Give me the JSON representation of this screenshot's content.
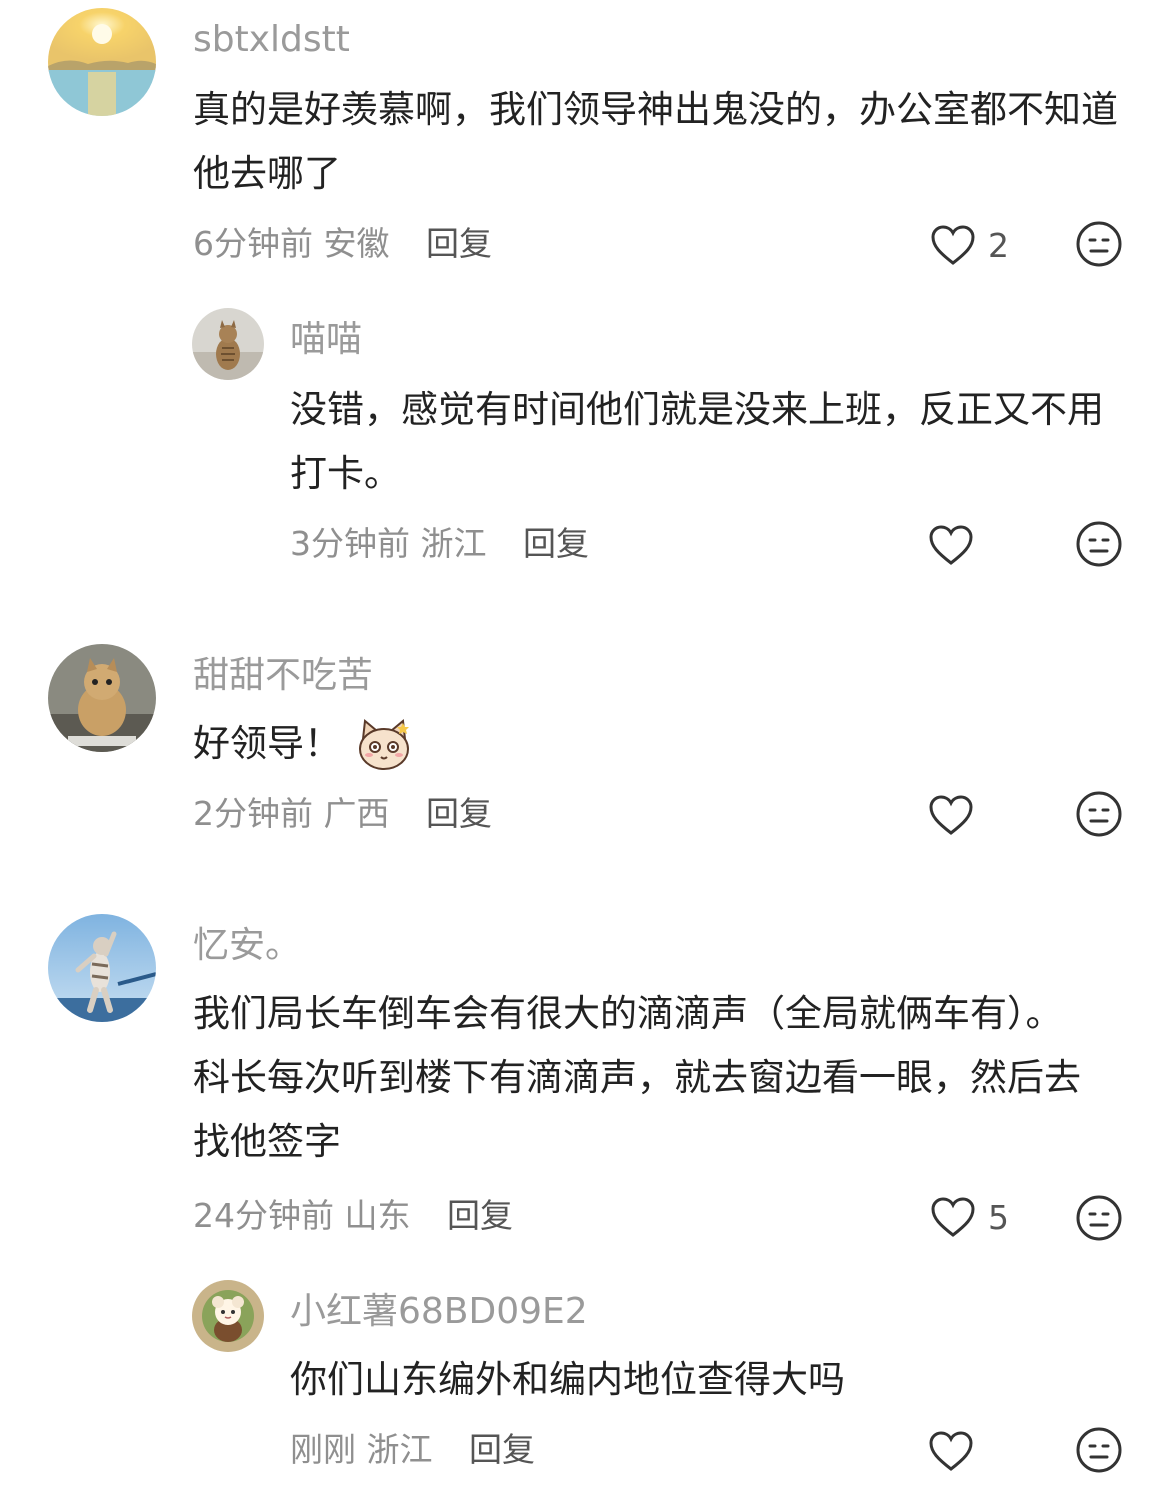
{
  "comments": [
    {
      "username": "sbtxldstt",
      "text": "真的是好羡慕啊，我们领导神出鬼没的，办公室都不知道他去哪了",
      "time": "6分钟前",
      "location": "安徽",
      "reply_label": "回复",
      "like_count": "2",
      "avatar_icon": "sunset-sea-avatar",
      "replies": [
        {
          "username": "喵喵",
          "text": "没错，感觉有时间他们就是没来上班，反正又不用打卡。",
          "time": "3分钟前",
          "location": "浙江",
          "reply_label": "回复",
          "like_count": "",
          "avatar_icon": "cat-avatar"
        }
      ]
    },
    {
      "username": "甜甜不吃苦",
      "text": "好领导！",
      "emoji_icon": "cat-sticker-emoji",
      "time": "2分钟前",
      "location": "广西",
      "reply_label": "回复",
      "like_count": "",
      "avatar_icon": "cat-meme-avatar",
      "replies": []
    },
    {
      "username": "忆安。",
      "text": "我们局长车倒车会有很大的滴滴声（全局就俩车有）。科长每次听到楼下有滴滴声，就去窗边看一眼，然后去找他签字",
      "time": "24分钟前",
      "location": "山东",
      "reply_label": "回复",
      "like_count": "5",
      "avatar_icon": "dancing-cat-avatar",
      "replies": [
        {
          "username": "小红薯68BD09E2",
          "text": "你们山东编外和编内地位查得大吗",
          "time": "刚刚",
          "location": "浙江",
          "reply_label": "回复",
          "like_count": "",
          "avatar_icon": "cartoon-avatar"
        }
      ]
    }
  ],
  "icons": {
    "like": "heart-outline-icon",
    "dislike": "neutral-face-icon"
  },
  "colors": {
    "name": "#9a9a9a",
    "meta": "#8f8f8f",
    "text": "#222222"
  }
}
